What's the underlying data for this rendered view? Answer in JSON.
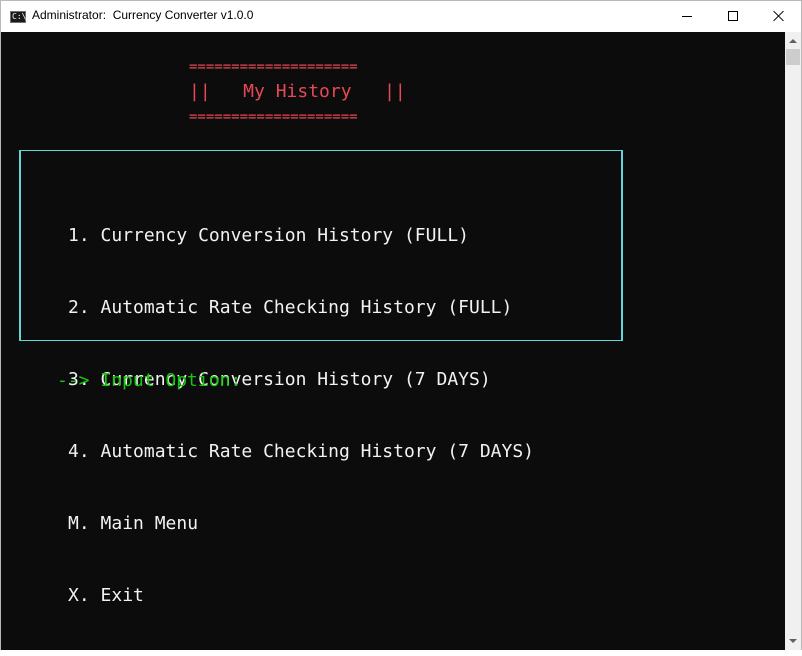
{
  "window": {
    "title": "Administrator:  Currency Converter v1.0.0",
    "icon_glyph": "C:\\"
  },
  "banner": {
    "top_rule": "====================",
    "title_line": "||   My History   ||",
    "bottom_rule": "===================="
  },
  "menu": {
    "items": [
      {
        "key": "1.",
        "label": "Currency Conversion History (FULL)"
      },
      {
        "key": "2.",
        "label": "Automatic Rate Checking History (FULL)"
      },
      {
        "key": "3.",
        "label": "Currency Conversion History (7 DAYS)"
      },
      {
        "key": "4.",
        "label": "Automatic Rate Checking History (7 DAYS)"
      },
      {
        "key": "M.",
        "label": "Main Menu"
      },
      {
        "key": "X.",
        "label": "Exit"
      }
    ]
  },
  "prompt": {
    "text": "--> Input Option:"
  },
  "colors": {
    "console_bg": "#0c0c0c",
    "banner": "#e74856",
    "menu_text": "#f2f2f2",
    "box_border": "#61d6d6",
    "prompt": "#16c60c"
  },
  "icons": [
    "console-app-icon",
    "minimize-icon",
    "maximize-icon",
    "close-icon",
    "scroll-up-icon",
    "scroll-down-icon"
  ]
}
